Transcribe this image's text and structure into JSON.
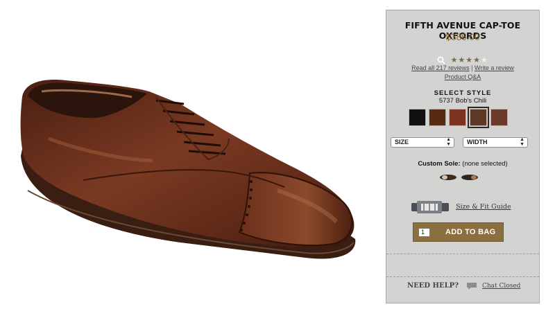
{
  "product": {
    "title": "FIFTH AVENUE CAP-TOE OXFORDS",
    "price": "$385.00",
    "rating_stars": 4.5,
    "image_alt_icon": "oxford-shoe-image"
  },
  "reviews": {
    "read_all": "Read all 217 reviews",
    "separator": "|",
    "write": "Write a review",
    "qa": "Product Q&A"
  },
  "style": {
    "label": "SELECT STYLE",
    "selected_name": "5737 Bob's Chili",
    "swatches": [
      {
        "color": "#101010",
        "name": "black"
      },
      {
        "color": "#5a2a10",
        "name": "walnut"
      },
      {
        "color": "#7a3420",
        "name": "chili-red"
      },
      {
        "color": "#5e3a26",
        "name": "bobs-chili",
        "selected": true
      },
      {
        "color": "#6a3a2c",
        "name": "burgundy"
      }
    ]
  },
  "selects": {
    "size": "SIZE",
    "width": "WIDTH"
  },
  "sole": {
    "label": "Custom Sole:",
    "value": "(none selected)"
  },
  "fit": {
    "link": "Size & Fit Guide"
  },
  "cart": {
    "qty": "1",
    "button": "ADD TO BAG"
  },
  "help": {
    "label": "NEED HELP?",
    "chat": "Chat Closed"
  },
  "colors": {
    "panel_bg": "#d3d4d2",
    "price": "#8a6a2f",
    "button": "#8b6f3f"
  }
}
